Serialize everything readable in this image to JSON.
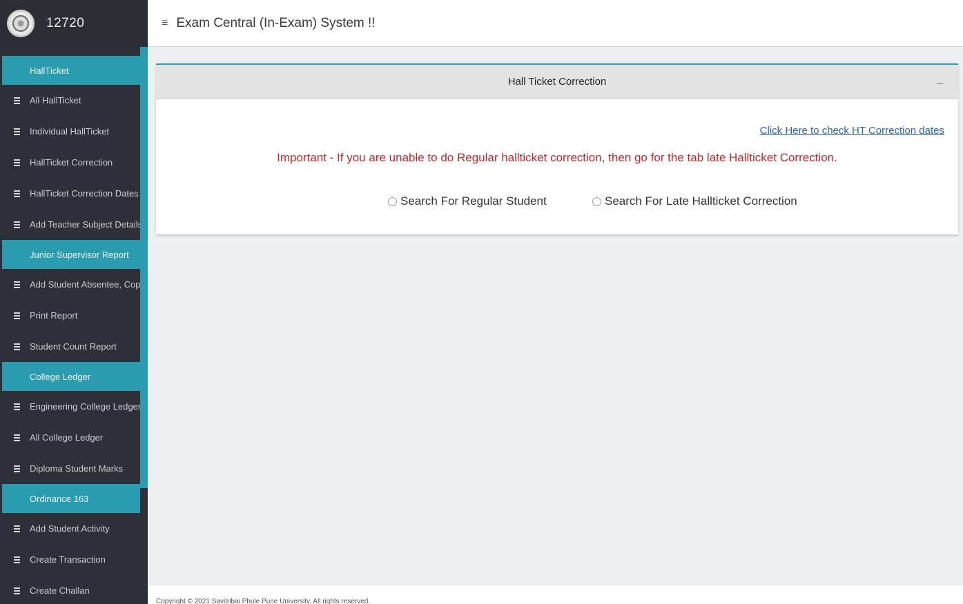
{
  "brand": {
    "user_id": "12720",
    "logo_icon": "university-seal-icon"
  },
  "topbar": {
    "menu_icon": "hamburger-icon",
    "title": "Exam Central (In-Exam) System !!"
  },
  "sidebar": {
    "groups": [
      {
        "header": "HallTicket",
        "items": [
          "All HallTicket",
          "Individual HallTicket",
          "HallTicket Correction",
          "HallTicket Correction Dates",
          "Add Teacher Subject Details"
        ]
      },
      {
        "header": "Junior Supervisor Report",
        "items": [
          "Add Student Absentee, Copy C",
          "Print Report",
          "Student Count Report"
        ]
      },
      {
        "header": "College Ledger",
        "items": [
          "Engineering College Ledger",
          "All College Ledger",
          "Diploma Student Marks"
        ]
      },
      {
        "header": "Ordinance 163",
        "items": [
          "Add Student Activity",
          "Create Transaction",
          "Create Challan"
        ]
      }
    ]
  },
  "panel": {
    "title": "Hall Ticket Correction",
    "collapse_icon": "minus-icon",
    "link": "Click Here to check HT Correction dates",
    "notice": "Important - If you are unable to do Regular hallticket correction, then go for the tab late Hallticket Correction.",
    "radio_regular": "Search For Regular Student",
    "radio_late": "Search For Late Hallticket Correction"
  },
  "footer": {
    "text": "Copyright © 2021 Savitribai Phule Pune University. All rights reserved."
  },
  "colors": {
    "accent": "#2a9cb0",
    "sidebar_bg": "#2d3038",
    "notice_red": "#c9262c",
    "link_blue": "#2a64b5"
  }
}
